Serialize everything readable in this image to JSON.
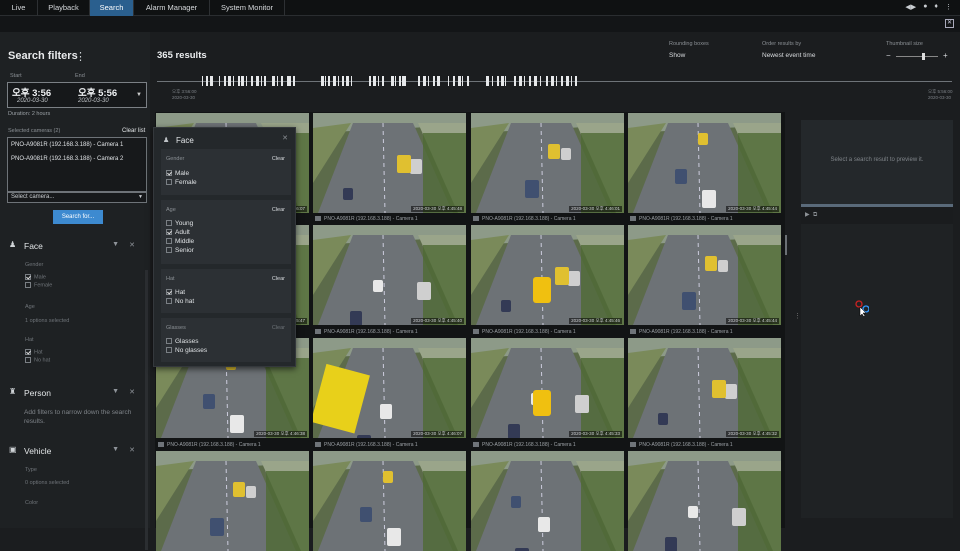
{
  "tabs": [
    {
      "label": "Live"
    },
    {
      "label": "Playback"
    },
    {
      "label": "Search",
      "active": true
    },
    {
      "label": "Alarm Manager"
    },
    {
      "label": "System Monitor"
    }
  ],
  "filters": {
    "title": "Search filters",
    "start_label": "Start",
    "end_label": "End",
    "start_time": "오후 3:56",
    "start_date": "2020-03-30",
    "end_time": "오후 5:56",
    "end_date": "2020-03-30",
    "duration": "Duration: 2 hours",
    "selected_cameras_label": "Selected cameras (2)",
    "clear_list": "Clear list",
    "cameras": [
      "PNO-A9081R (192.168.3.188) - Camera 1",
      "PNO-A9081R (192.168.3.188) - Camera 2"
    ],
    "select_camera": "Select camera...",
    "search_button": "Search for...",
    "face": {
      "title": "Face",
      "gender_label": "Gender",
      "male": "Male",
      "female": "Female",
      "age_label": "Age",
      "age_value": "1 options selected",
      "hat_label": "Hat",
      "hat": "Hat",
      "no_hat": "No hat"
    },
    "person": {
      "title": "Person",
      "hint": "Add filters to narrow down the search results."
    },
    "vehicle": {
      "title": "Vehicle",
      "type_label": "Type",
      "type_value": "0 options selected",
      "color_label": "Color"
    }
  },
  "results": {
    "count": "365 results",
    "rounding_label": "Rounding boxes",
    "rounding_value": "Show",
    "order_label": "Order results by",
    "order_value": "Newest event time",
    "thumb_label": "Thumbnail size",
    "thumb_minus": "−",
    "thumb_plus": "+",
    "timeline_start": "오후 3:56:00",
    "timeline_start_date": "2020-03-30",
    "timeline_end": "오후 5:56:00",
    "timeline_end_date": "2020-03-30",
    "camera_caption": "PNO-A9081R (192.168.3.188) - Camera 1",
    "timestamps": [
      "2020-03-30 오후 4:46:07",
      "2020-03-30 오후 4:45:48",
      "2020-03-30 오후 4:46:01",
      "2020-03-30 오후 4:45:44",
      "2020-03-30 오후 4:45:47",
      "2020-03-30 오후 4:45:40",
      "2020-03-30 오후 4:45:46",
      "2020-03-30 오후 4:45:44",
      "2020-03-30 오후 4:46:38",
      "2020-03-30 오후 4:46:07",
      "2020-03-30 오후 4:45:33",
      "2020-03-30 오후 4:45:32"
    ],
    "tl_markers": [
      0,
      1
    ]
  },
  "face_panel": {
    "title": "Face",
    "gender": {
      "label": "Gender",
      "clear": "Clear",
      "items": [
        "Male",
        "Female"
      ]
    },
    "age": {
      "label": "Age",
      "clear": "Clear",
      "items": [
        "Young",
        "Adult",
        "Middle",
        "Senior"
      ]
    },
    "hat": {
      "label": "Hat",
      "clear": "Clear",
      "items": [
        "Hat",
        "No hat"
      ]
    },
    "glasses": {
      "label": "Glasses",
      "clear": "Clear",
      "items": [
        "Glasses",
        "No glasses"
      ]
    }
  },
  "preview": {
    "message": "Select a search result to preview it."
  },
  "colors": {
    "accent": "#2a5f8e",
    "button": "#3d8ad0"
  }
}
